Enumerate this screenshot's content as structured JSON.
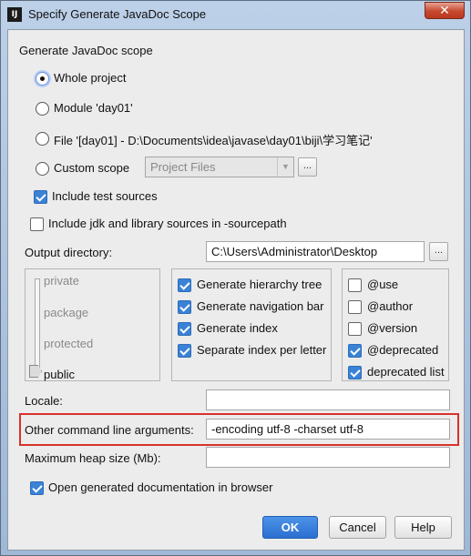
{
  "window": {
    "title": "Specify Generate JavaDoc Scope",
    "close_glyph": "✕",
    "app_icon_text": "IJ"
  },
  "scope": {
    "heading": "Generate JavaDoc scope",
    "options": [
      {
        "label": "Whole project",
        "selected": true
      },
      {
        "label": "Module 'day01'",
        "selected": false
      },
      {
        "label": "File '[day01] - D:\\Documents\\idea\\javase\\day01\\biji\\学习笔记'",
        "selected": false
      },
      {
        "label": "Custom scope",
        "selected": false
      }
    ],
    "custom_scope_value": "Project Files",
    "browse_glyph": "...",
    "include_test_sources": {
      "label": "Include test sources",
      "checked": true
    },
    "include_jdk": {
      "label": "Include jdk and library sources in -sourcepath",
      "checked": false
    }
  },
  "output": {
    "label": "Output directory:",
    "value": "C:\\Users\\Administrator\\Desktop",
    "browse_glyph": "..."
  },
  "visibility": {
    "levels": [
      "private",
      "package",
      "protected",
      "public"
    ],
    "selected": "public"
  },
  "generate_options": [
    {
      "label": "Generate hierarchy tree",
      "checked": true
    },
    {
      "label": "Generate navigation bar",
      "checked": true
    },
    {
      "label": "Generate index",
      "checked": true
    },
    {
      "label": "Separate index per letter",
      "checked": true
    }
  ],
  "tag_options": [
    {
      "label": "@use",
      "checked": false
    },
    {
      "label": "@author",
      "checked": false
    },
    {
      "label": "@version",
      "checked": false
    },
    {
      "label": "@deprecated",
      "checked": true
    },
    {
      "label": "deprecated list",
      "checked": true
    }
  ],
  "locale": {
    "label": "Locale:",
    "value": ""
  },
  "other_args": {
    "label": "Other command line arguments:",
    "value": "-encoding utf-8 -charset utf-8",
    "highlight_color": "#d9312b"
  },
  "heap": {
    "label": "Maximum heap size (Mb):",
    "value": ""
  },
  "open_in_browser": {
    "label": "Open generated documentation in browser",
    "checked": true
  },
  "buttons": {
    "ok": "OK",
    "cancel": "Cancel",
    "help": "Help"
  },
  "colors": {
    "accent": "#3a82d6",
    "ok_button": "#2b6fd0",
    "highlight": "#d9312b"
  }
}
